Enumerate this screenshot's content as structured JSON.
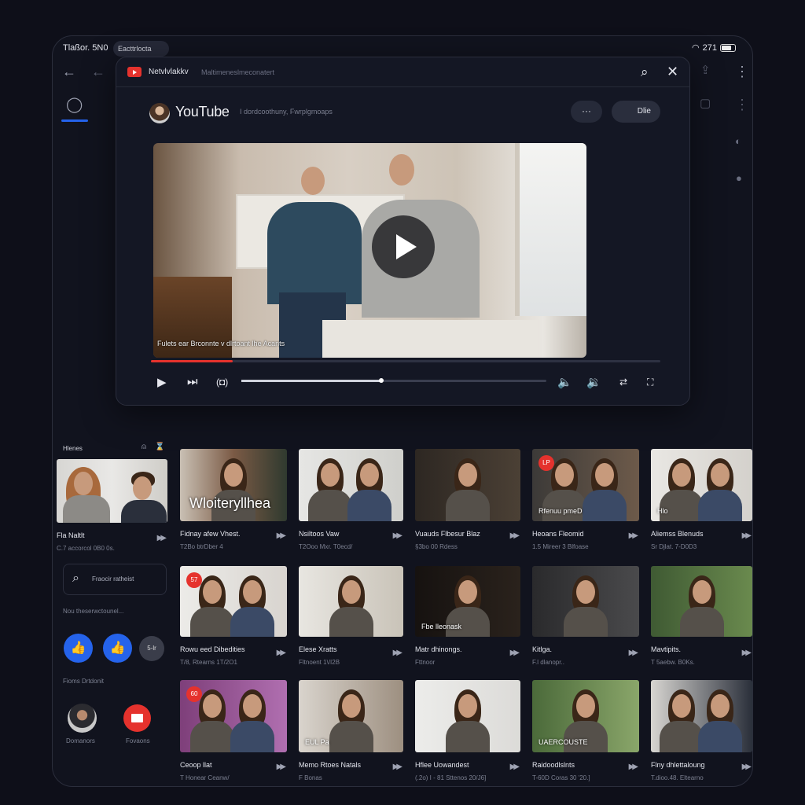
{
  "status_bar": {
    "left_text": "Tlaßor. 5N0",
    "pill": "Eacttrlocta",
    "right_text": "271"
  },
  "modal": {
    "app_title": "Netvlvlakkv",
    "app_subtitle": "Maltimeneslmeconatert",
    "channel_name": "YouTube",
    "channel_sub": "I dordcoothuny,   Fwrplgmoaps",
    "more_label": "···",
    "subscribe_label": "Dlie",
    "video_caption": "Fulets ear Brconnte v dlrtoant lhe Acants",
    "progress_percent": 16,
    "scrub_percent": 46
  },
  "sidebar": {
    "header": "Hlenes",
    "feature_title": "Fla Naltlt",
    "feature_meta": "C.7 accorcol 0B0 0s.",
    "search_placeholder": "Fraocir ratheist",
    "section1": "Nou theserwctounel...",
    "more_label": "5-lr",
    "section2": "Fioms Drtdonit",
    "avatar_label": "Domanors",
    "red_label": "Fovaons"
  },
  "grid": [
    {
      "title": "Fidnay afew Vhest.",
      "meta": "T2Bo btrDber 4",
      "overlay": "Wloiteryllhea"
    },
    {
      "title": "Nsiltoos Vaw",
      "meta": "T2Ooo Mxr. T0ecd/"
    },
    {
      "title": "Vuauds Flbesur Blaz",
      "meta": "§3bo 00 Rdess"
    },
    {
      "title": "Heoans Fleomid",
      "meta": "1.5 Mireer 3 Blfoase",
      "badge": "LP",
      "overlay": "Rfenuu pmeD"
    },
    {
      "title": "Aliemss Blenuds",
      "meta": "Sr Djlat. 7-D0D3",
      "overlay": "Hlo"
    },
    {
      "title": "Rowu eed Dibedities",
      "meta": "T/8, Rtearns 1T/2O1",
      "badge": "57"
    },
    {
      "title": "Elese Xratts",
      "meta": "Fltnoent 1\\/I2B"
    },
    {
      "title": "Matr dhinongs.",
      "meta": "Fttnoor",
      "overlay": "Fbe lleonask"
    },
    {
      "title": "Kitlga.",
      "meta": "F.l dlanopr.."
    },
    {
      "title": "Mavtipits.",
      "meta": "T 5aebw. B0Ks."
    },
    {
      "title": "Ceoop llat",
      "meta": "T Honear Ceanw/",
      "badge": "60"
    },
    {
      "title": "Memo Rtoes Natals",
      "meta": "F Bonas",
      "overlay": "EUL Pa"
    },
    {
      "title": "Hflee Uowandest",
      "meta": "(.2o) I - 81 Sttenos 20/J6]",
      "overlay": ""
    },
    {
      "title": "Raidoodlslnts",
      "meta": "T-60D Coras 30 '20.]",
      "overlay": "UAERCOUSTE"
    },
    {
      "title": "Flny dhlettaloung",
      "meta": "T.dioo.48. Eltearno"
    }
  ],
  "colors": {
    "accent": "#2563eb",
    "brand_red": "#e5322d",
    "background": "#0e0f19"
  }
}
